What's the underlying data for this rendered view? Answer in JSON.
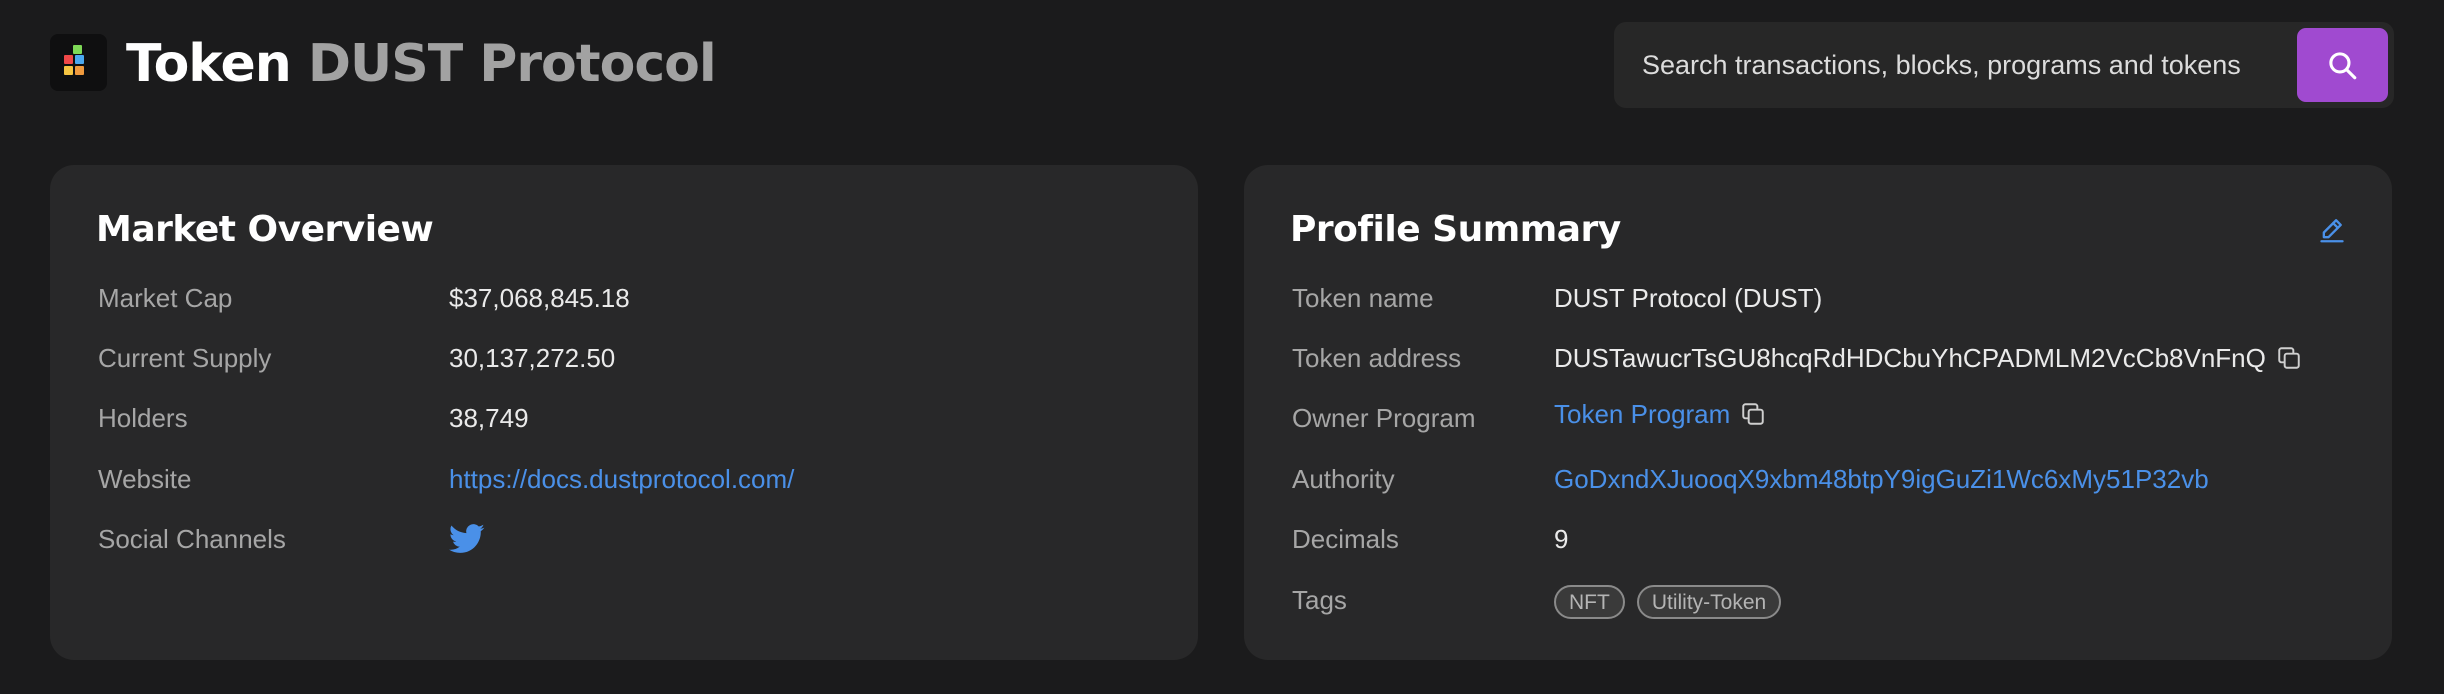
{
  "header": {
    "title_prefix": "Token",
    "title_name": "DUST Protocol",
    "search": {
      "placeholder": "Search transactions, blocks, programs and tokens",
      "value": ""
    }
  },
  "colors": {
    "background": "#1b1b1c",
    "card": "#282829",
    "accent_purple": "#a04ad0",
    "link_blue": "#4a90e8",
    "label_gray": "#a6a6a6"
  },
  "market_overview": {
    "title": "Market Overview",
    "rows": [
      {
        "label": "Market Cap",
        "value": "$37,068,845.18"
      },
      {
        "label": "Current Supply",
        "value": "30,137,272.50"
      },
      {
        "label": "Holders",
        "value": "38,749"
      },
      {
        "label": "Website",
        "value": "https://docs.dustprotocol.com/"
      },
      {
        "label": "Social Channels",
        "icon": "twitter-icon"
      }
    ]
  },
  "profile_summary": {
    "title": "Profile Summary",
    "edit_icon": "pencil-icon",
    "rows": [
      {
        "label": "Token name",
        "value": "DUST Protocol (DUST)"
      },
      {
        "label": "Token address",
        "value": "DUSTawucrTsGU8hcqRdHDCbuYhCPADMLM2VcCb8VnFnQ",
        "icon": "copy-icon"
      },
      {
        "label": "Owner Program",
        "value": "Token Program",
        "icon": "copy-icon"
      },
      {
        "label": "Authority",
        "value": "GoDxndXJuooqX9xbm48btpY9igGuZi1Wc6xMy51P32vb"
      },
      {
        "label": "Decimals",
        "value": "9"
      },
      {
        "label": "Tags",
        "tags": [
          "NFT",
          "Utility-Token"
        ]
      }
    ]
  }
}
